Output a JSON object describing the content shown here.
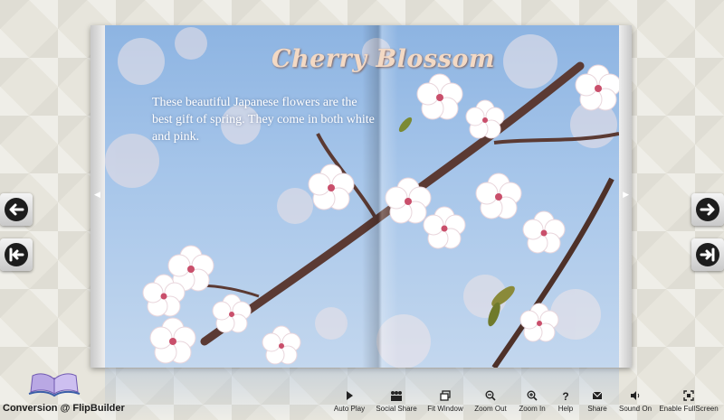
{
  "page": {
    "title": "Cherry Blossom",
    "description": "These beautiful Japanese flowers are the best gift of spring. They come in both white and pink."
  },
  "branding": {
    "text": "Conversion @ FlipBuilder"
  },
  "toolbar": {
    "items": [
      {
        "id": "auto-play",
        "label": "Auto Play",
        "icon": "play-icon"
      },
      {
        "id": "social-share",
        "label": "Social Share",
        "icon": "people-icon"
      },
      {
        "id": "fit-window",
        "label": "Fit Window",
        "icon": "window-icon"
      },
      {
        "id": "zoom-out",
        "label": "Zoom Out",
        "icon": "zoom-out-icon"
      },
      {
        "id": "zoom-in",
        "label": "Zoom In",
        "icon": "zoom-in-icon"
      },
      {
        "id": "help",
        "label": "Help",
        "icon": "question-icon"
      },
      {
        "id": "share",
        "label": "Share",
        "icon": "envelope-icon"
      },
      {
        "id": "sound-on",
        "label": "Sound On",
        "icon": "speaker-icon"
      },
      {
        "id": "enable-fullscreen",
        "label": "Enable FullScreen",
        "icon": "fullscreen-icon"
      }
    ]
  },
  "nav": {
    "previous": "arrow-left-icon",
    "first": "first-page-icon",
    "next": "arrow-right-icon",
    "last": "last-page-icon"
  },
  "colors": {
    "background": "#e7e5dc",
    "sky": "#8db4e2",
    "title": "#f3d9c4"
  }
}
